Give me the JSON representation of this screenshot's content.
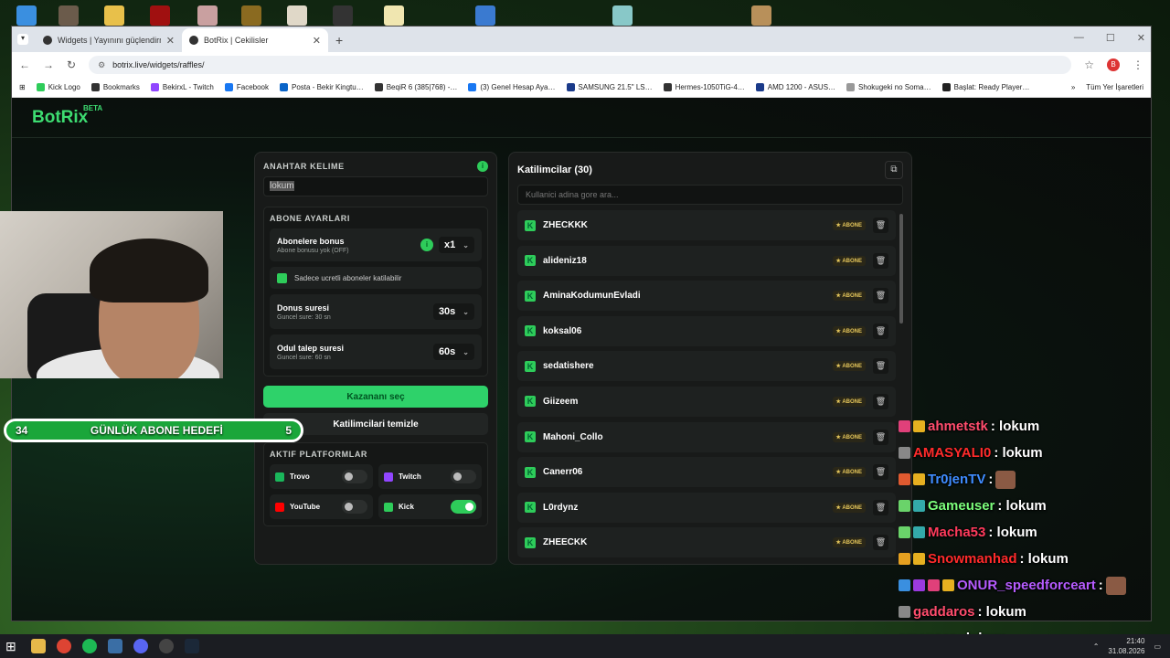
{
  "browser": {
    "tabs": [
      {
        "title": "Widgets | Yayınını güçlendirme…",
        "active": false
      },
      {
        "title": "BotRix | Cekilisler",
        "active": true
      }
    ],
    "url": "botrix.live/widgets/raffles/",
    "avatar_letter": "B",
    "bookmarks": [
      {
        "label": "Kick Logo",
        "color": "#2ecc5a"
      },
      {
        "label": "Bookmarks",
        "color": "#333333"
      },
      {
        "label": "BekirxL - Twitch",
        "color": "#9146ff"
      },
      {
        "label": "Facebook",
        "color": "#1877f2"
      },
      {
        "label": "Posta - Bekir Kingtu…",
        "color": "#0a64c8"
      },
      {
        "label": "BeqiR 6 (385|768) -…",
        "color": "#333333"
      },
      {
        "label": "(3) Genel Hesap Aya…",
        "color": "#1877f2"
      },
      {
        "label": "SAMSUNG 21.5\" LS…",
        "color": "#1a3a8a"
      },
      {
        "label": "Hermes-1050TiG-4…",
        "color": "#333333"
      },
      {
        "label": "AMD 1200 - ASUS…",
        "color": "#1a3a8a"
      },
      {
        "label": "Shokugeki no Soma…",
        "color": "#999999"
      },
      {
        "label": "Başlat: Ready Player…",
        "color": "#222222"
      }
    ],
    "bookmarks_more": "»",
    "bookmarks_all": "Tüm Yer İşaretleri"
  },
  "app": {
    "brand": "BotRix",
    "brand_sup": "BETA",
    "accent": "#2ecc5a"
  },
  "raffle": {
    "keyword_label": "ANAHTAR KELIME",
    "keyword_value": "lokum",
    "sub_settings_label": "ABONE AYARLARI",
    "sub_bonus_title": "Abonelere bonus",
    "sub_bonus_sub": "Abone bonusu yok (OFF)",
    "sub_bonus_value": "x1",
    "paid_only_label": "Sadece ucretli aboneler katilabilir",
    "duration_title": "Donus suresi",
    "duration_sub": "Guncel sure: 30 sn",
    "duration_value": "30s",
    "claim_title": "Odul talep suresi",
    "claim_sub": "Guncel sure: 60 sn",
    "claim_value": "60s",
    "pick_winner": "Kazananı seç",
    "clear_participants": "Katilimcilari temizle",
    "platforms_label": "AKTIF PLATFORMLAR",
    "platforms": [
      {
        "name": "Trovo",
        "color": "#1ab75b",
        "on": false
      },
      {
        "name": "Twitch",
        "color": "#9146ff",
        "on": false
      },
      {
        "name": "YouTube",
        "color": "#ff0000",
        "on": false
      },
      {
        "name": "Kick",
        "color": "#2ecc5a",
        "on": true
      }
    ]
  },
  "participants": {
    "title": "Katilimcilar (30)",
    "search_placeholder": "Kullanici adina gore ara...",
    "badge": "ABONE",
    "items": [
      "ZHECKKK",
      "alideniz18",
      "AminaKodumunEvladi",
      "koksal06",
      "sedatishere",
      "Giizeem",
      "Mahoni_Collo",
      "Canerr06",
      "L0rdynz",
      "ZHEECKK"
    ]
  },
  "overlay": {
    "goal_left": "34",
    "goal_label": "GÜNLÜK ABONE HEDEFİ",
    "goal_right": "5",
    "chat": [
      {
        "user": "ahmetstk",
        "color": "#ff4d6d",
        "msg": ": lokum"
      },
      {
        "user": "AMASYALI0",
        "color": "#ff2b2b",
        "msg": ": lokum"
      },
      {
        "user": "Tr0jenTV",
        "color": "#3f8cff",
        "msg": ":"
      },
      {
        "user": "Gameuser",
        "color": "#7cff7c",
        "msg": ": lokum"
      },
      {
        "user": "Macha53",
        "color": "#ff3b5c",
        "msg": ": lokum"
      },
      {
        "user": "Snowmanhad",
        "color": "#ff2b2b",
        "msg": ": lokum"
      },
      {
        "user": "ONUR_speedforceart",
        "color": "#b65cff",
        "msg": ":"
      },
      {
        "user": "gaddaros",
        "color": "#ff4d6d",
        "msg": ": lokum"
      },
      {
        "user": "ameuser",
        "color": "#ffffff",
        "msg": ": lokum"
      }
    ]
  },
  "taskbar": {
    "time": "21:40",
    "date": "31.08.2026"
  }
}
